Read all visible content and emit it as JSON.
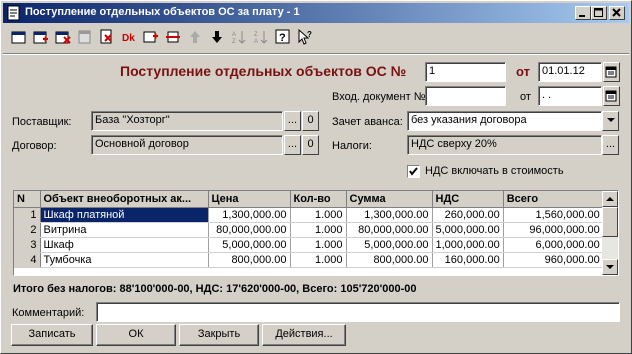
{
  "window": {
    "title": "Поступление отдельных объектов ОС за плату - 1"
  },
  "toolbar": {
    "icons": [
      "new-doc-icon",
      "copy-doc-icon",
      "delete-doc-icon",
      "post-doc-icon",
      "print-doc-icon",
      "dt-kt-icon",
      "edit-row-icon",
      "row-delete-icon",
      "move-up-icon",
      "move-down-icon",
      "sort-asc-icon",
      "sort-desc-icon",
      "help-icon",
      "context-help-icon"
    ]
  },
  "header": {
    "title": "Поступление отдельных объектов ОС №",
    "number": "1",
    "from_label": "от",
    "date": "01.01.12",
    "in_doc_label": "Вход. документ №",
    "in_doc_number": "",
    "in_doc_from_label": "от",
    "in_doc_date": " .  .  "
  },
  "form": {
    "supplier_label": "Поставщик:",
    "supplier_value": "База \"Хозторг\"",
    "contract_label": "Договор:",
    "contract_value": "Основной договор",
    "advance_label": "Зачет аванса:",
    "advance_value": "без указания договора",
    "taxes_label": "Налоги:",
    "taxes_value": "НДС сверху 20%",
    "vat_include_label": "НДС включать в стоимость",
    "vat_include_checked": true,
    "ellipsis": "...",
    "clear": "0"
  },
  "table": {
    "columns": [
      "N",
      "Объект внеоборотных ак...",
      "Цена",
      "Кол-во",
      "Сумма",
      "НДС",
      "Всего"
    ],
    "rows": [
      [
        "1",
        "Шкаф платяной",
        "1,300,000.00",
        "1.000",
        "1,300,000.00",
        "260,000.00",
        "1,560,000.00"
      ],
      [
        "2",
        "Витрина",
        "80,000,000.00",
        "1.000",
        "80,000,000.00",
        "5,000,000.00",
        "96,000,000.00"
      ],
      [
        "3",
        "Шкаф",
        "5,000,000.00",
        "1.000",
        "5,000,000.00",
        "1,000,000.00",
        "6,000,000.00"
      ],
      [
        "4",
        "Тумбочка",
        "800,000.00",
        "1.000",
        "800,000.00",
        "160,000.00",
        "960,000.00"
      ]
    ]
  },
  "totals": "Итого без налогов: 88'100'000-00, НДС: 17'620'000-00, Всего: 105'720'000-00",
  "comment": {
    "label": "Комментарий:",
    "value": ""
  },
  "buttons": {
    "save": "Записать",
    "ok": "ОК",
    "close": "Закрыть",
    "actions": "Действия..."
  }
}
